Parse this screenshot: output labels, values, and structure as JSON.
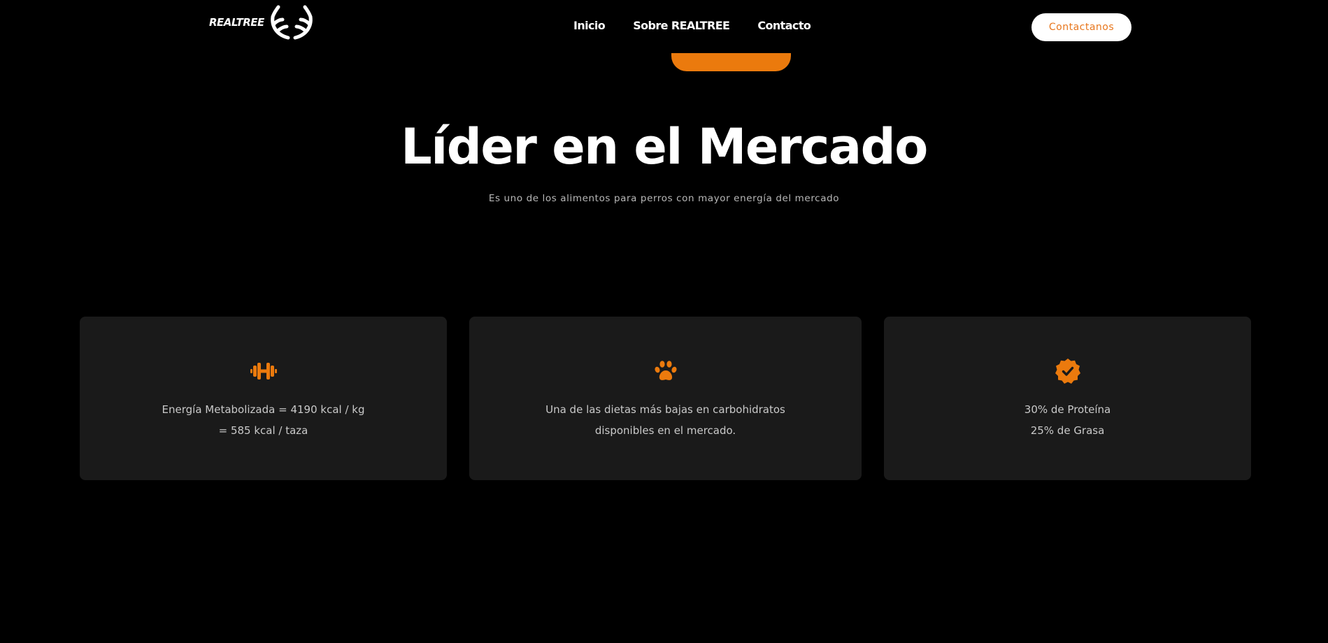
{
  "header": {
    "logo_text": "REALTREE",
    "nav": [
      "Inicio",
      "Sobre REALTREE",
      "Contacto"
    ],
    "cta_label": "Contactanos"
  },
  "hero": {
    "title": "Líder en el Mercado",
    "subtitle": "Es uno de los alimentos para perros con mayor energía del mercado"
  },
  "cards": [
    {
      "icon": "dumbbell-icon",
      "lines": [
        "Energía Metabolizada = 4190 kcal / kg",
        "= 585 kcal / taza"
      ]
    },
    {
      "icon": "paw-icon",
      "lines": [
        "Una de las dietas más bajas en carbohidratos",
        "disponibles en el mercado."
      ]
    },
    {
      "icon": "check-badge-icon",
      "lines": [
        "30% de Proteína",
        "25% de Grasa"
      ]
    }
  ],
  "colors": {
    "background": "#000000",
    "accent": "#eb7a0d",
    "card": "#1a1a1a",
    "text": "#ffffff",
    "muted": "#c9c9c9"
  }
}
